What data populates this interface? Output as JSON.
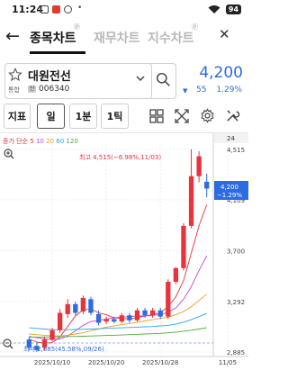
{
  "status": {
    "time": "11:24",
    "battery": "94"
  },
  "header": {
    "back_label": "←",
    "tabs": [
      {
        "label": "종목차트",
        "active": true
      },
      {
        "label": "재무차트",
        "active": false
      },
      {
        "label": "지수차트",
        "active": false
      }
    ]
  },
  "stock": {
    "name": "대원전선",
    "market": "통합",
    "code": "006340",
    "price": "4,200",
    "change_arrow": "▼",
    "change_amount": "55",
    "change_percent": "1.29%"
  },
  "toolbar": {
    "indicator_label": "지표",
    "period_label": "일",
    "min_label": "1분",
    "tick_label": "1틱"
  },
  "chart_meta": {
    "ma_prefix": "종가 단순",
    "ma_periods": [
      "5",
      "10",
      "20",
      "60",
      "120"
    ],
    "ma_colors": [
      "#e0323c",
      "#c04ad0",
      "#e8a020",
      "#36a4e0",
      "#4caa40"
    ],
    "period_count": "24",
    "max_note": "최고 4,515(−6.98%,11/03)",
    "min_note": "최저 2,885(45.58%,09/26)",
    "current_price_tag": "4,200",
    "current_change_tag": "−1.29%",
    "up_color": "#e8333c",
    "down_color": "#2d6be0"
  },
  "chart_data": {
    "type": "candlestick",
    "title": "",
    "y_ticks": [
      "4,515",
      "4,109",
      "3,700",
      "3,292",
      "2,885"
    ],
    "x_ticks": [
      "2025/10/10",
      "2025/10/20",
      "2025/10/28",
      "11/05"
    ],
    "ylim": [
      2885,
      4515
    ],
    "candles": [
      {
        "o": 2985,
        "c": 2920,
        "h": 3005,
        "l": 2900
      },
      {
        "o": 2935,
        "c": 2900,
        "h": 2960,
        "l": 2885
      },
      {
        "o": 2920,
        "c": 2985,
        "h": 3010,
        "l": 2900
      },
      {
        "o": 2985,
        "c": 3060,
        "h": 3080,
        "l": 2970
      },
      {
        "o": 3060,
        "c": 3200,
        "h": 3230,
        "l": 3040
      },
      {
        "o": 3190,
        "c": 3270,
        "h": 3310,
        "l": 3160
      },
      {
        "o": 3270,
        "c": 3200,
        "h": 3290,
        "l": 3180
      },
      {
        "o": 3210,
        "c": 3320,
        "h": 3340,
        "l": 3190
      },
      {
        "o": 3310,
        "c": 3200,
        "h": 3330,
        "l": 3180
      },
      {
        "o": 3190,
        "c": 3120,
        "h": 3220,
        "l": 3100
      },
      {
        "o": 3130,
        "c": 3150,
        "h": 3170,
        "l": 3110
      },
      {
        "o": 3150,
        "c": 3130,
        "h": 3170,
        "l": 3115
      },
      {
        "o": 3130,
        "c": 3180,
        "h": 3200,
        "l": 3115
      },
      {
        "o": 3180,
        "c": 3140,
        "h": 3200,
        "l": 3120
      },
      {
        "o": 3140,
        "c": 3220,
        "h": 3240,
        "l": 3130
      },
      {
        "o": 3220,
        "c": 3180,
        "h": 3240,
        "l": 3160
      },
      {
        "o": 3180,
        "c": 3220,
        "h": 3240,
        "l": 3160
      },
      {
        "o": 3220,
        "c": 3170,
        "h": 3240,
        "l": 3150
      },
      {
        "o": 3170,
        "c": 3450,
        "h": 3470,
        "l": 3150
      },
      {
        "o": 3450,
        "c": 3560,
        "h": 3570,
        "l": 3430
      },
      {
        "o": 3560,
        "c": 3900,
        "h": 3920,
        "l": 3540
      },
      {
        "o": 3900,
        "c": 4300,
        "h": 4515,
        "l": 3880
      },
      {
        "o": 4300,
        "c": 4460,
        "h": 4500,
        "l": 4250
      },
      {
        "o": 4255,
        "c": 4200,
        "h": 4320,
        "l": 4130
      }
    ],
    "ma5": [
      2990,
      2965,
      2955,
      2960,
      3005,
      3090,
      3175,
      3225,
      3230,
      3200,
      3185,
      3160,
      3155,
      3150,
      3160,
      3175,
      3185,
      3200,
      3250,
      3330,
      3460,
      3680,
      3900,
      4070
    ],
    "ma10": [
      3010,
      3000,
      2990,
      2985,
      2990,
      3015,
      3055,
      3100,
      3130,
      3140,
      3150,
      3160,
      3165,
      3170,
      3175,
      3175,
      3180,
      3185,
      3205,
      3240,
      3310,
      3410,
      3540,
      3660
    ],
    "ma20": [
      3030,
      3025,
      3020,
      3015,
      3015,
      3020,
      3030,
      3040,
      3055,
      3070,
      3085,
      3095,
      3105,
      3115,
      3125,
      3135,
      3145,
      3155,
      3165,
      3185,
      3210,
      3250,
      3300,
      3350
    ],
    "ma60": [
      3080,
      3075,
      3070,
      3065,
      3065,
      3065,
      3066,
      3068,
      3070,
      3072,
      3075,
      3078,
      3080,
      3082,
      3085,
      3088,
      3090,
      3095,
      3100,
      3110,
      3125,
      3145,
      3170,
      3195
    ],
    "ma120": [
      3005,
      3005,
      3006,
      3007,
      3008,
      3009,
      3010,
      3012,
      3014,
      3016,
      3018,
      3020,
      3022,
      3025,
      3028,
      3030,
      3032,
      3035,
      3040,
      3045,
      3052,
      3060,
      3070,
      3080
    ]
  }
}
